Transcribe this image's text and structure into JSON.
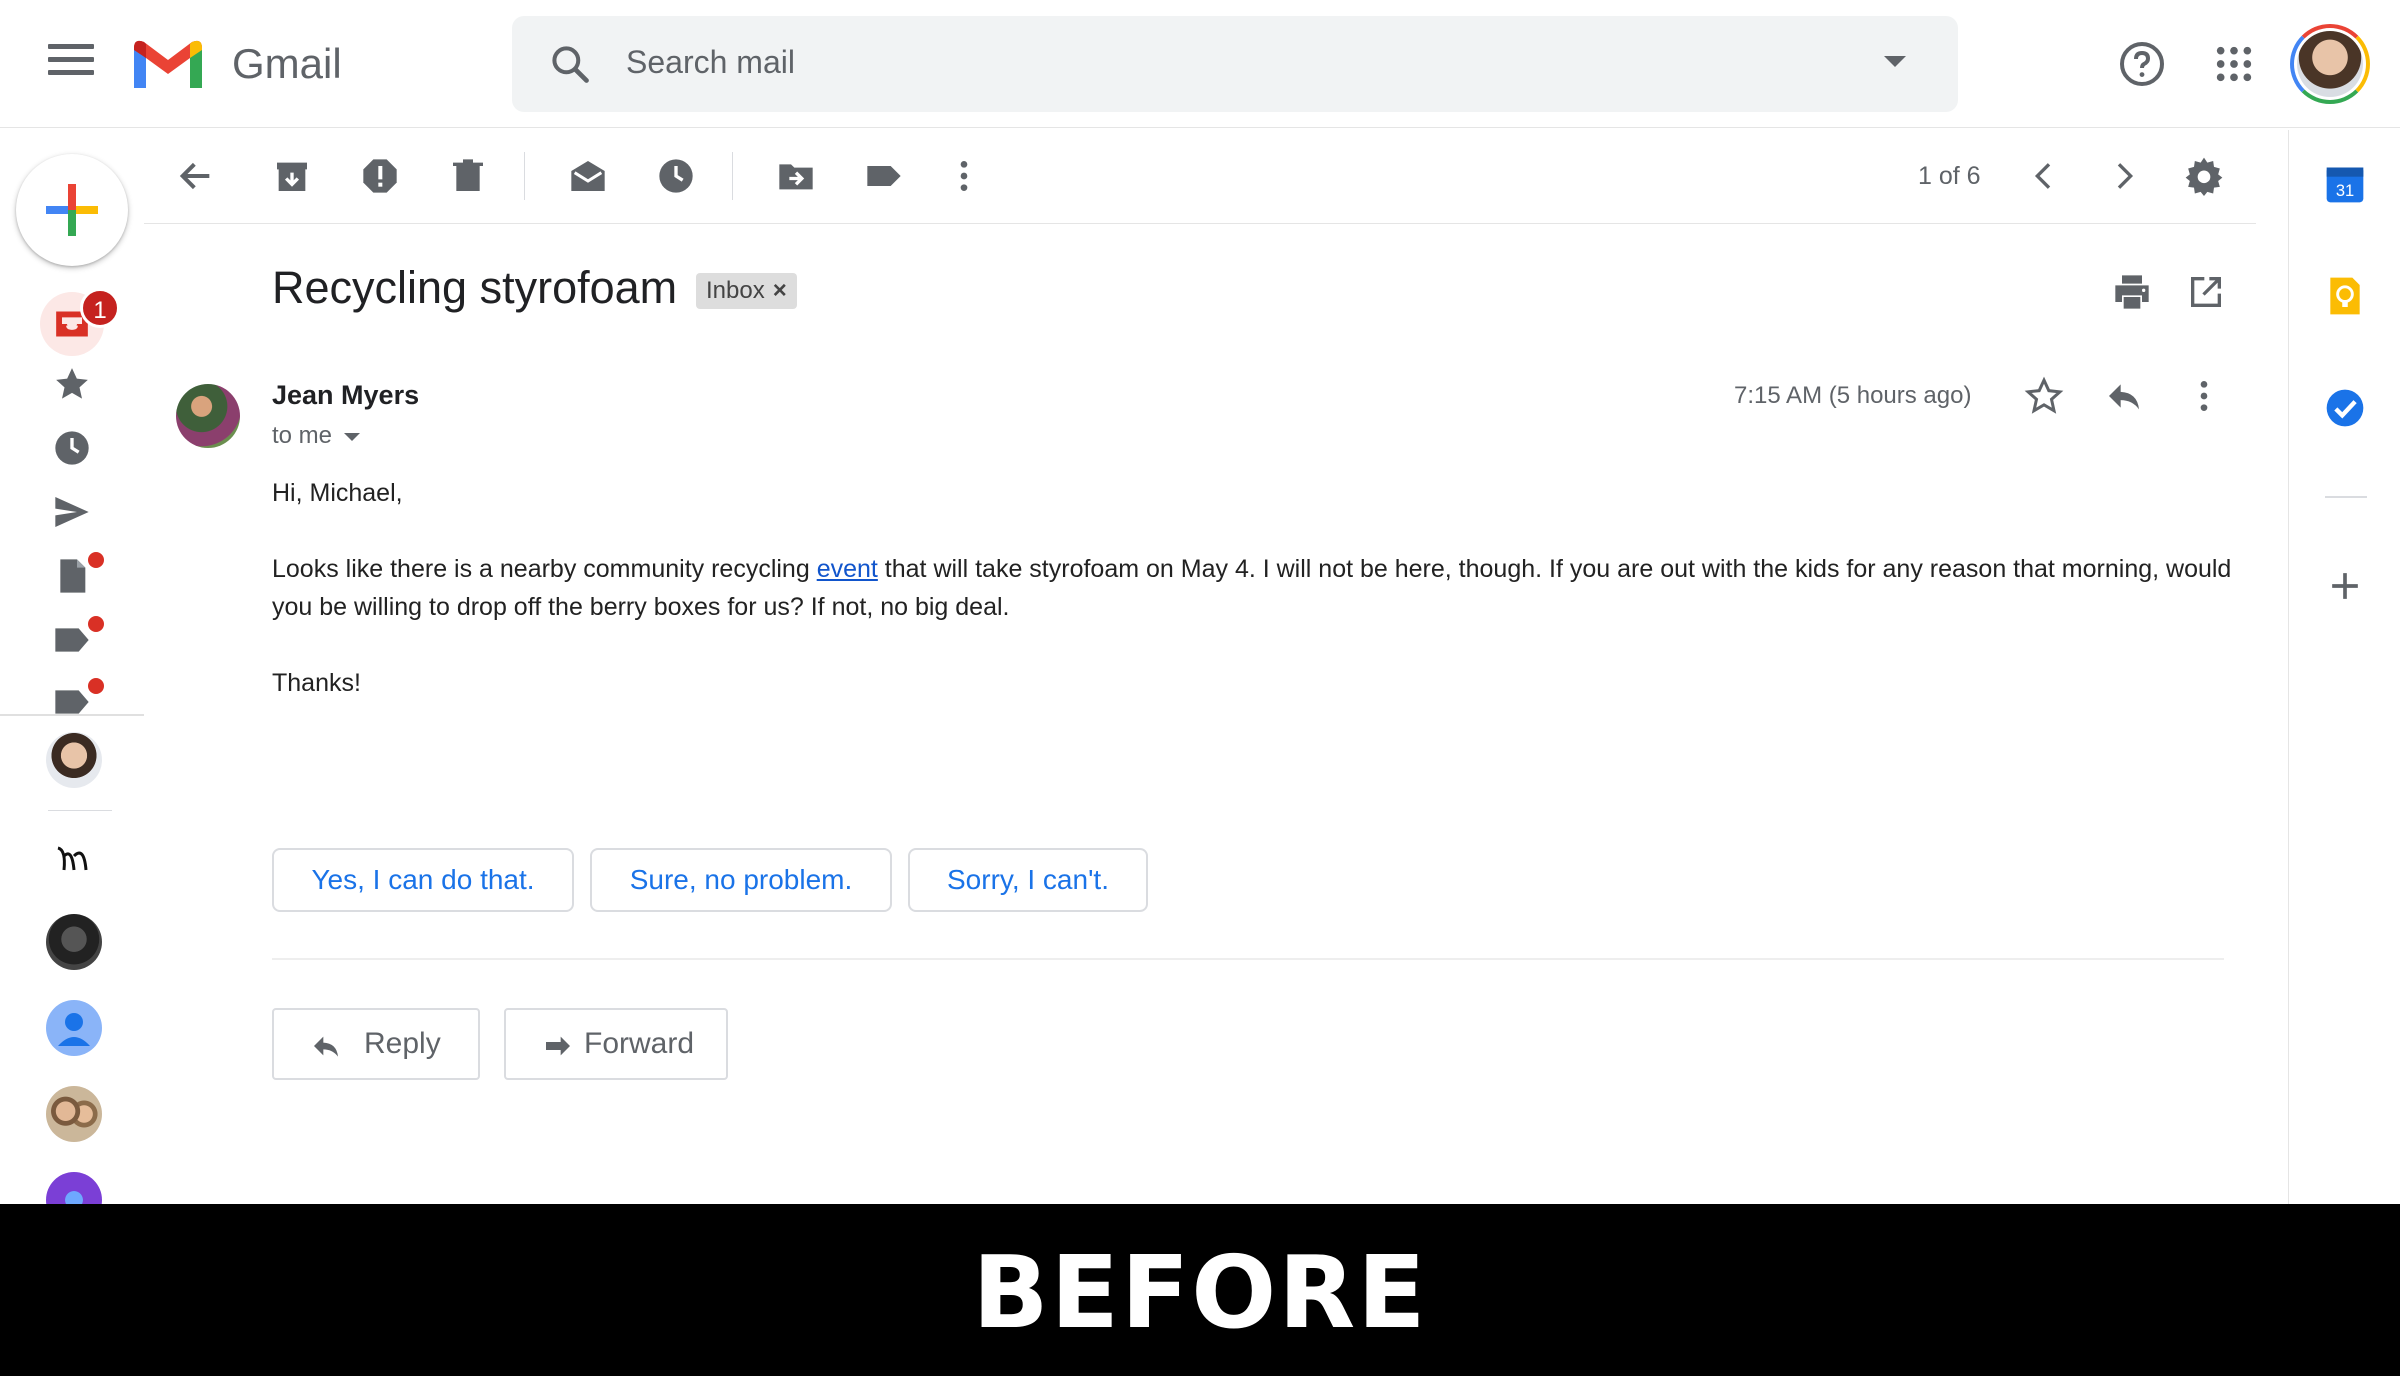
{
  "header": {
    "brand": "Gmail",
    "search_placeholder": "Search mail"
  },
  "rail": {
    "inbox_badge": "1"
  },
  "toolbar": {
    "pager": "1 of 6"
  },
  "email": {
    "subject": "Recycling styrofoam",
    "label_chip": "Inbox",
    "label_chip_close": "×",
    "sender": "Jean Myers",
    "recipient": "to me",
    "time": "7:15 AM (5 hours ago)",
    "greeting": "Hi, Michael,",
    "body_before_link": "Looks like there is a nearby community recycling ",
    "link_text": "event",
    "body_after_link": " that will take styrofoam on May 4. I will not be here, though. If you are out with the kids for any reason that morning, would you be willing to drop off the berry boxes for us? If not, no big deal.",
    "signoff": "Thanks!"
  },
  "smart_replies": [
    "Yes, I can do that.",
    "Sure, no problem.",
    "Sorry, I can't."
  ],
  "actions": {
    "reply": "Reply",
    "forward": "Forward"
  },
  "side_panel": {
    "calendar_day": "31"
  },
  "footer": {
    "caption": "BEFORE"
  },
  "colors": {
    "accent_blue": "#1a73e8",
    "badge_red": "#c5221f",
    "gmail_red": "#ea4335"
  }
}
